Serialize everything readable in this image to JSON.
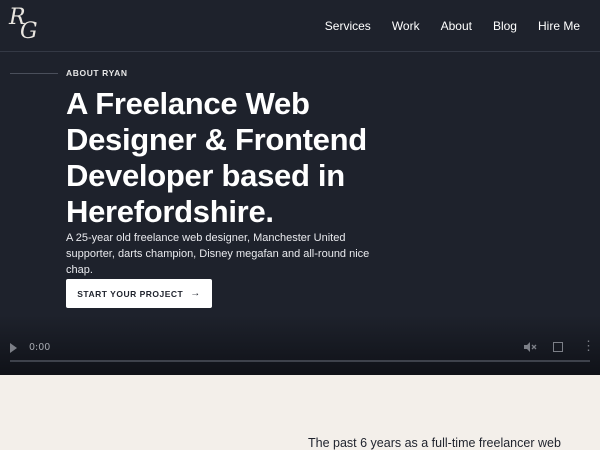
{
  "logo": {
    "letter_r": "R",
    "letter_g": "G"
  },
  "nav": {
    "items": [
      {
        "label": "Services"
      },
      {
        "label": "Work"
      },
      {
        "label": "About"
      },
      {
        "label": "Blog"
      },
      {
        "label": "Hire Me"
      }
    ]
  },
  "hero": {
    "eyebrow": "ABOUT RYAN",
    "headline": "A Freelance Web Designer & Frontend Developer based in Herefordshire.",
    "intro": "A 25-year old freelance web designer, Manchester United supporter, darts champion, Disney megafan and all-round nice chap.",
    "cta_label": "START YOUR PROJECT",
    "cta_icon": "arrow-right-icon"
  },
  "video": {
    "time": "0:00",
    "progress": 0,
    "play_icon": "play-icon",
    "mute_icon": "speaker-muted-icon",
    "fullscreen_icon": "fullscreen-icon",
    "more_icon": "more-vertical-icon"
  },
  "about": {
    "text": "The past 6 years as a full-time freelancer web"
  },
  "colors": {
    "hero_bg": "#1e222c",
    "page_bg": "#f3efea",
    "text_light": "#ffffff",
    "text_dark": "#1e222c"
  }
}
